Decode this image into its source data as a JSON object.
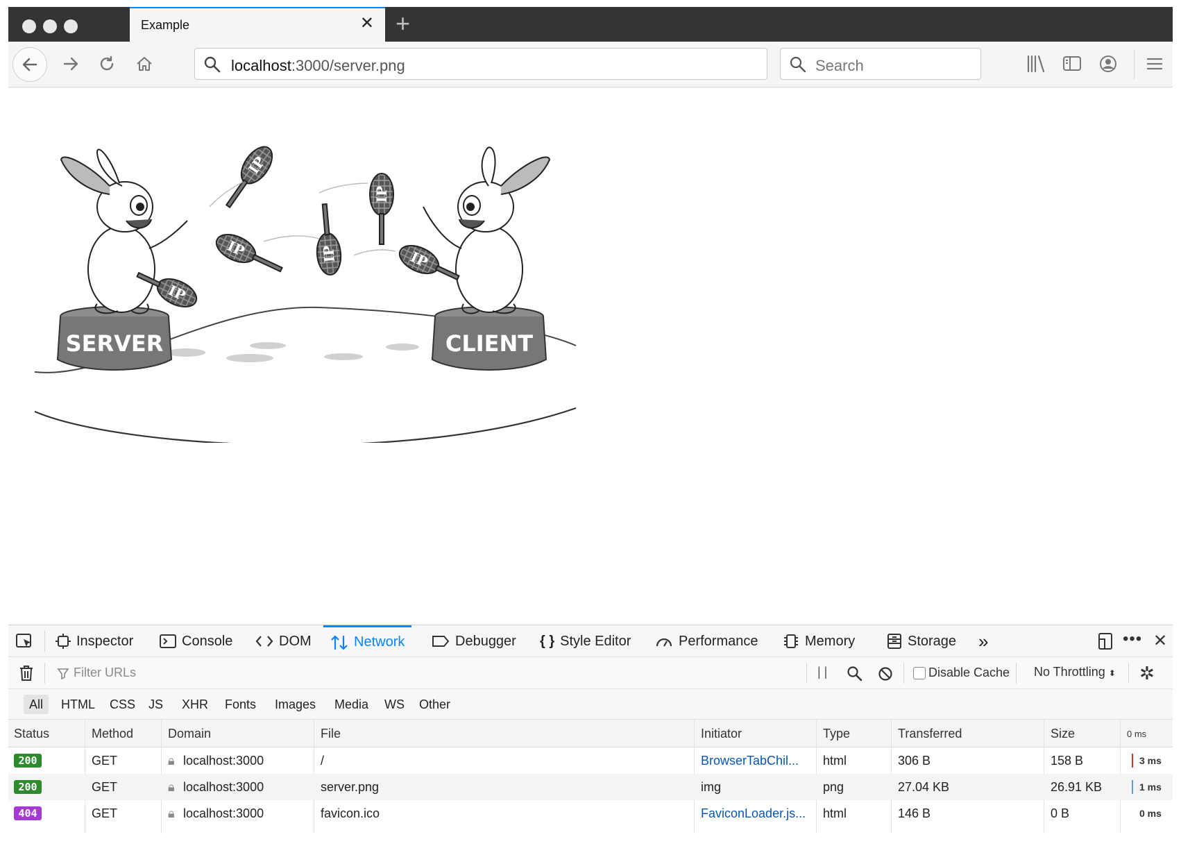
{
  "browser": {
    "tab_title": "Example",
    "url_host": "localhost",
    "url_path": ":3000/server.png",
    "search_placeholder": "Search"
  },
  "illustration": {
    "left_pedestal": "SERVER",
    "right_pedestal": "CLIENT",
    "pin_text": "IP"
  },
  "devtools": {
    "tabs": [
      {
        "label": "Inspector"
      },
      {
        "label": "Console"
      },
      {
        "label": "DOM"
      },
      {
        "label": "Network",
        "active": true
      },
      {
        "label": "Debugger"
      },
      {
        "label": "Style Editor"
      },
      {
        "label": "Performance"
      },
      {
        "label": "Memory"
      },
      {
        "label": "Storage"
      }
    ],
    "filter_placeholder": "Filter URLs",
    "pause_label": "| |",
    "disable_cache_label": "Disable Cache",
    "throttling_label": "No Throttling",
    "types": [
      "All",
      "HTML",
      "CSS",
      "JS",
      "XHR",
      "Fonts",
      "Images",
      "Media",
      "WS",
      "Other"
    ],
    "columns": [
      "Status",
      "Method",
      "Domain",
      "File",
      "Initiator",
      "Type",
      "Transferred",
      "Size",
      "0 ms"
    ],
    "rows": [
      {
        "status": "200",
        "method": "GET",
        "domain": "localhost:3000",
        "file": "/",
        "initiator": "BrowserTabChil...",
        "type": "html",
        "transferred": "306 B",
        "size": "158 B",
        "timing": "3 ms"
      },
      {
        "status": "200",
        "method": "GET",
        "domain": "localhost:3000",
        "file": "server.png",
        "initiator": "img",
        "type": "png",
        "transferred": "27.04 KB",
        "size": "26.91 KB",
        "timing": "1 ms"
      },
      {
        "status": "404",
        "method": "GET",
        "domain": "localhost:3000",
        "file": "favicon.ico",
        "initiator": "FaviconLoader.js...",
        "type": "html",
        "transferred": "146 B",
        "size": "0 B",
        "timing": "0 ms"
      }
    ],
    "colors": {
      "ok": "#2d8a2d",
      "not_found": "#a43ad2",
      "accent": "#0a84ff"
    }
  }
}
